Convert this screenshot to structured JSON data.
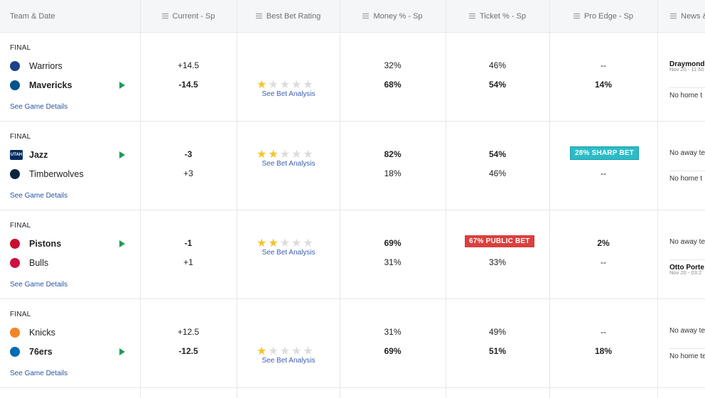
{
  "headers": [
    {
      "label": "Team & Date",
      "menu": false
    },
    {
      "label": "Current - Sp",
      "menu": true
    },
    {
      "label": "Best Bet Rating",
      "menu": true
    },
    {
      "label": "Money % - Sp",
      "menu": true
    },
    {
      "label": "Ticket % - Sp",
      "menu": true
    },
    {
      "label": "Pro Edge - Sp",
      "menu": true
    },
    {
      "label": "News &",
      "menu": true
    }
  ],
  "status_final": "FINAL",
  "details_label": "See Game Details",
  "analysis_label": "See Bet Analysis",
  "games": [
    {
      "teams": [
        {
          "name": "Warriors",
          "logo_color": "#1d428a",
          "logo_text": "",
          "spread": "+14.5",
          "money": "32%",
          "ticket": "46%",
          "edge": "--",
          "fav": false
        },
        {
          "name": "Mavericks",
          "logo_color": "#00538c",
          "logo_text": "",
          "spread": "-14.5",
          "money": "68%",
          "ticket": "54%",
          "edge": "14%",
          "fav": true
        }
      ],
      "stars": 1,
      "ticket_badge": null,
      "edge_badge": null,
      "news": [
        {
          "type": "head",
          "text": "Draymond"
        },
        {
          "type": "sub",
          "text": "Nov 20 - 11:50"
        },
        {
          "type": "none",
          "text": "No home t"
        }
      ]
    },
    {
      "teams": [
        {
          "name": "Jazz",
          "logo_color": "#002b5c",
          "logo_text": "UTAH",
          "spread": "-3",
          "money": "82%",
          "ticket": "54%",
          "edge": "",
          "fav": true
        },
        {
          "name": "Timberwolves",
          "logo_color": "#0c2340",
          "logo_text": "",
          "spread": "+3",
          "money": "18%",
          "ticket": "46%",
          "edge": "--",
          "fav": false
        }
      ],
      "stars": 2,
      "ticket_badge": null,
      "edge_badge": {
        "text": "28% SHARP BET",
        "color": "#2bbcc8"
      },
      "news": [
        {
          "type": "none",
          "text": "No away te"
        },
        {
          "type": "none",
          "text": "No home t"
        }
      ]
    },
    {
      "teams": [
        {
          "name": "Pistons",
          "logo_color": "#c8102e",
          "logo_text": "",
          "spread": "-1",
          "money": "69%",
          "ticket": "",
          "edge": "2%",
          "fav": true
        },
        {
          "name": "Bulls",
          "logo_color": "#ce1141",
          "logo_text": "",
          "spread": "+1",
          "money": "31%",
          "ticket": "33%",
          "edge": "--",
          "fav": false
        }
      ],
      "stars": 2,
      "ticket_badge": {
        "text": "67% PUBLIC BET",
        "color": "#d9403e"
      },
      "edge_badge": null,
      "news": [
        {
          "type": "none",
          "text": "No away te"
        },
        {
          "type": "head",
          "text": "Otto Porte"
        },
        {
          "type": "sub",
          "text": "Nov 20 - 03:2"
        }
      ]
    },
    {
      "teams": [
        {
          "name": "Knicks",
          "logo_color": "#f58426",
          "logo_text": "",
          "spread": "+12.5",
          "money": "31%",
          "ticket": "49%",
          "edge": "--",
          "fav": false
        },
        {
          "name": "76ers",
          "logo_color": "#006bb6",
          "logo_text": "",
          "spread": "-12.5",
          "money": "69%",
          "ticket": "51%",
          "edge": "18%",
          "fav": true
        }
      ],
      "stars": 1,
      "ticket_badge": null,
      "edge_badge": null,
      "news": [
        {
          "type": "none",
          "text": "No away te"
        },
        {
          "type": "none",
          "text": "No home te"
        }
      ]
    }
  ]
}
